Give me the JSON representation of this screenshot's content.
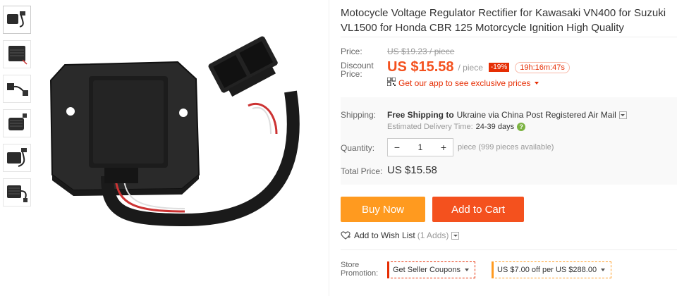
{
  "thumbnails": [
    {
      "alt": "regulator-thumb-1"
    },
    {
      "alt": "regulator-thumb-2"
    },
    {
      "alt": "regulator-thumb-3"
    },
    {
      "alt": "regulator-thumb-4"
    },
    {
      "alt": "regulator-thumb-5"
    },
    {
      "alt": "regulator-thumb-6"
    }
  ],
  "product": {
    "title": "Motocycle Voltage Regulator Rectifier for Kawasaki VN400 for Suzuki VL1500 for Honda CBR 125 Motorcycle Ignition High Quality"
  },
  "price": {
    "label": "Price:",
    "original": "US $19.23 / piece",
    "discount_label_1": "Discount",
    "discount_label_2": "Price:",
    "current": "US $15.58",
    "unit": "/ piece",
    "discount_badge": "-19%",
    "timer": "19h:16m:47s",
    "app_promo": "Get our app to see exclusive prices"
  },
  "shipping": {
    "label": "Shipping:",
    "prefix": "Free Shipping to",
    "destination": "Ukraine via China Post Registered Air Mail",
    "eta_label": "Estimated Delivery Time:",
    "eta_value": "24-39 days"
  },
  "quantity": {
    "label": "Quantity:",
    "minus": "−",
    "value": "1",
    "plus": "+",
    "availability": "piece (999 pieces available)"
  },
  "total": {
    "label": "Total Price:",
    "value": "US $15.58"
  },
  "actions": {
    "buy_now": "Buy Now",
    "add_to_cart": "Add to Cart",
    "wishlist": "Add to Wish List",
    "wishlist_count": "(1 Adds)"
  },
  "promotion": {
    "label_1": "Store",
    "label_2": "Promotion:",
    "seller_coupons": "Get Seller Coupons",
    "store_offer": "US $7.00 off per US $288.00"
  },
  "colors": {
    "accent": "#f4511e",
    "buy_now": "#ff9a1f",
    "discount": "#e62e04"
  }
}
